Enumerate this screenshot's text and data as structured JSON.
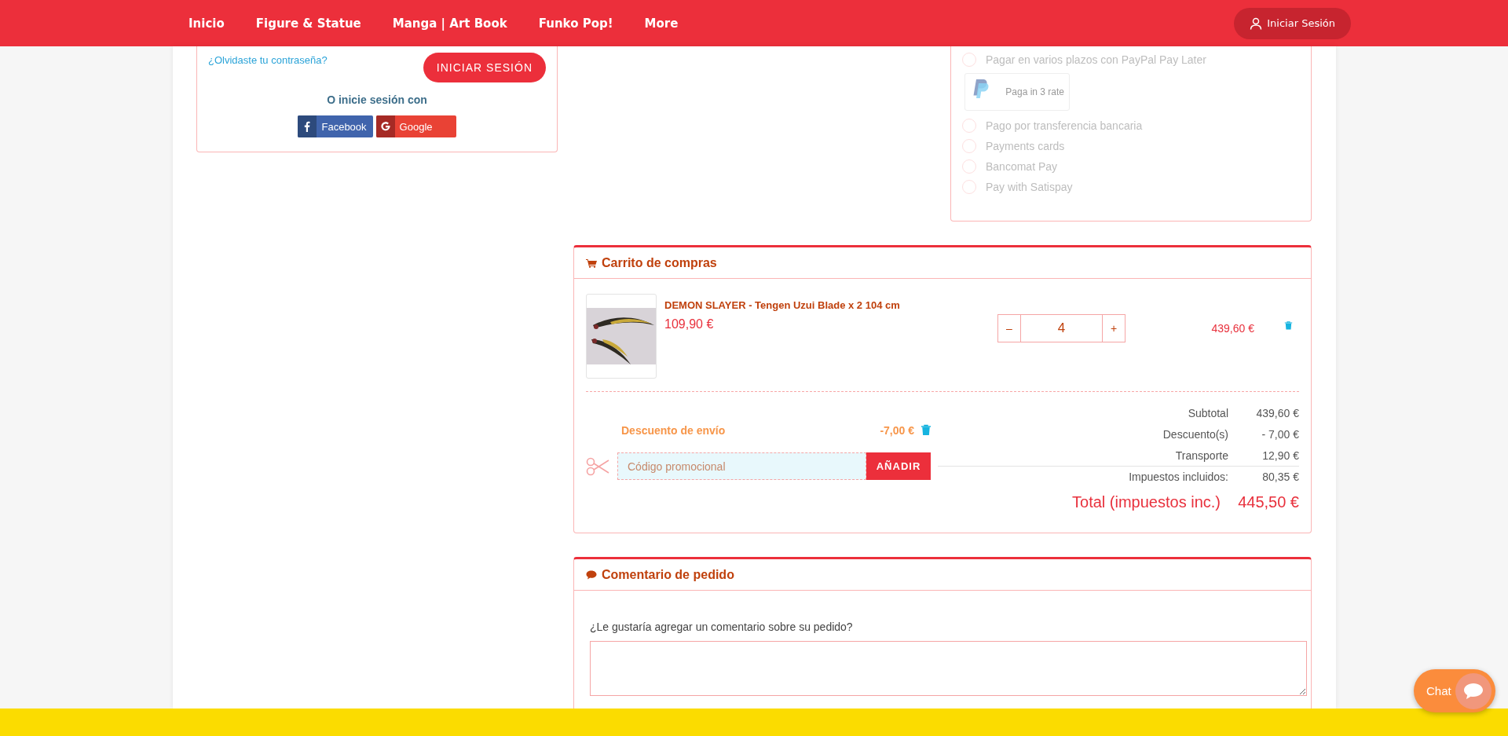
{
  "nav": {
    "items": [
      "Inicio",
      "Figure & Statue",
      "Manga | Art Book",
      "Funko Pop!",
      "More"
    ],
    "login": "Iniciar Sesión"
  },
  "login_box": {
    "forgot_link": "¿Olvidaste tu contraseña?",
    "submit": "INICIAR SESIÓN",
    "social_prompt": "O inicie sesión con",
    "social": [
      {
        "kind": "facebook",
        "label": "Facebook"
      },
      {
        "kind": "google",
        "label": "Google"
      }
    ]
  },
  "payment": {
    "options": [
      {
        "label": "Pagar en varios plazos con PayPal Pay Later",
        "selected": false,
        "badge": "Paga in 3 rate"
      },
      {
        "label": "Pago por transferencia bancaria",
        "selected": false
      },
      {
        "label": "Payments cards",
        "selected": false
      },
      {
        "label": "Bancomat Pay",
        "selected": false
      },
      {
        "label": "Pay with Satispay",
        "selected": false
      }
    ]
  },
  "cart": {
    "title": "Carrito de compras",
    "items": [
      {
        "name": "DEMON SLAYER - Tengen Uzui Blade x 2 104 cm",
        "price": "109,90 €",
        "decrement": "–",
        "quantity": "4",
        "increment": "+",
        "total": "439,60 €"
      }
    ],
    "discount": {
      "label": "Descuento de envío",
      "amount": "-7,00 €"
    },
    "promo": {
      "placeholder": "Código promocional",
      "button": "AÑADIR"
    },
    "totals": [
      {
        "kind": "line",
        "label": "Subtotal",
        "value": "439,60 €"
      },
      {
        "kind": "line",
        "label": "Descuento(s)",
        "value": "- 7,00 €"
      },
      {
        "kind": "line",
        "label": "Transporte",
        "value": "12,90 €"
      },
      {
        "kind": "tax",
        "label": "Impuestos incluidos:",
        "value": "80,35 €"
      },
      {
        "kind": "grand",
        "label": "Total (impuestos inc.)",
        "value": "445,50 €"
      }
    ]
  },
  "comment": {
    "title": "Comentario de pedido",
    "question": "¿Le gustaría agregar un comentario sobre su pedido?"
  },
  "chat": {
    "label": "Chat"
  }
}
